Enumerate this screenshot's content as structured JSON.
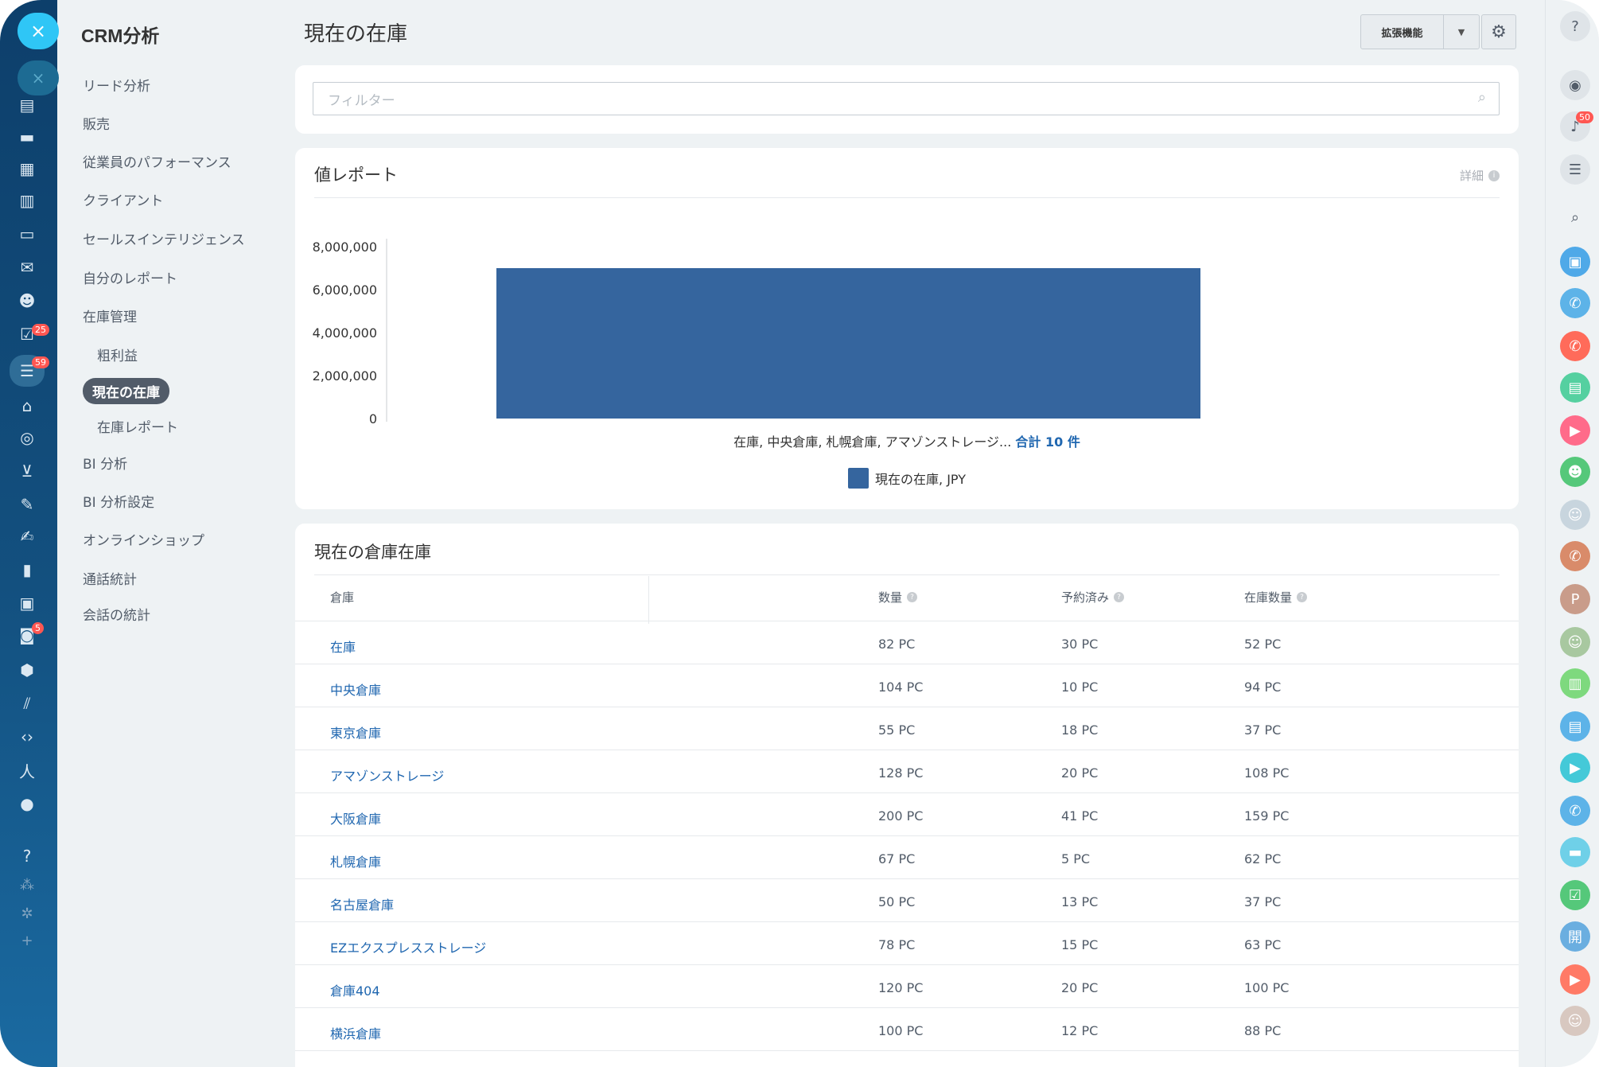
{
  "app": {
    "close_symbol": "×"
  },
  "menu": {
    "title": "CRM分析",
    "items": [
      {
        "label": "リード分析"
      },
      {
        "label": "販売"
      },
      {
        "label": "従業員のパフォーマンス"
      },
      {
        "label": "クライアント"
      },
      {
        "label": "セールスインテリジェンス"
      },
      {
        "label": "自分のレポート"
      },
      {
        "label": "在庫管理"
      },
      {
        "label": "粗利益"
      },
      {
        "label": "現在の在庫"
      },
      {
        "label": "在庫レポート"
      },
      {
        "label": "BI 分析"
      },
      {
        "label": "BI 分析設定"
      },
      {
        "label": "オンラインショップ"
      },
      {
        "label": "通話統計"
      },
      {
        "label": "会話の統計"
      }
    ]
  },
  "rail": {
    "badges": [
      "25",
      "59",
      "5"
    ]
  },
  "header": {
    "title": "現在の在庫",
    "extensions_label": "拡張機能"
  },
  "filter": {
    "placeholder": "フィルター"
  },
  "report": {
    "heading": "値レポート",
    "details_label": "詳細"
  },
  "chart_data": {
    "type": "bar",
    "categories": [
      "在庫, 中央倉庫, 札幌倉庫, アマゾンストレージ..."
    ],
    "category_label_suffix": "合計 10 件",
    "series": [
      {
        "name": "現在の在庫, JPY",
        "values": [
          7000000
        ]
      }
    ],
    "yticks": [
      "8,000,000",
      "6,000,000",
      "4,000,000",
      "2,000,000",
      "0"
    ],
    "ylim": [
      0,
      8000000
    ],
    "bar_color": "#35659e",
    "legend_position": "bottom",
    "grid": false
  },
  "table": {
    "heading": "現在の倉庫在庫",
    "columns": [
      "倉庫",
      "数量",
      "予約済み",
      "在庫数量"
    ],
    "rows": [
      {
        "name": "在庫",
        "qty": "82 PC",
        "reserved": "30 PC",
        "stock": "52 PC"
      },
      {
        "name": "中央倉庫",
        "qty": "104 PC",
        "reserved": "10 PC",
        "stock": "94 PC"
      },
      {
        "name": "東京倉庫",
        "qty": "55 PC",
        "reserved": "18 PC",
        "stock": "37 PC"
      },
      {
        "name": "アマゾンストレージ",
        "qty": "128 PC",
        "reserved": "20 PC",
        "stock": "108 PC"
      },
      {
        "name": "大阪倉庫",
        "qty": "200 PC",
        "reserved": "41 PC",
        "stock": "159 PC"
      },
      {
        "name": "札幌倉庫",
        "qty": "67 PC",
        "reserved": "5 PC",
        "stock": "62 PC"
      },
      {
        "name": "名古屋倉庫",
        "qty": "50 PC",
        "reserved": "13 PC",
        "stock": "37 PC"
      },
      {
        "name": "EZエクスプレスストレージ",
        "qty": "78 PC",
        "reserved": "15 PC",
        "stock": "63 PC"
      },
      {
        "name": "倉庫404",
        "qty": "120 PC",
        "reserved": "20 PC",
        "stock": "100 PC"
      },
      {
        "name": "横浜倉庫",
        "qty": "100 PC",
        "reserved": "12 PC",
        "stock": "88 PC"
      }
    ]
  },
  "right_rail": {
    "notification_count": "50",
    "avatar_letter": "P",
    "chat_letter": "開"
  },
  "colors": {
    "accent": "#2fc6f6",
    "link": "#2067b0",
    "bar": "#35659e",
    "rail_top": "#0d3f6b"
  }
}
